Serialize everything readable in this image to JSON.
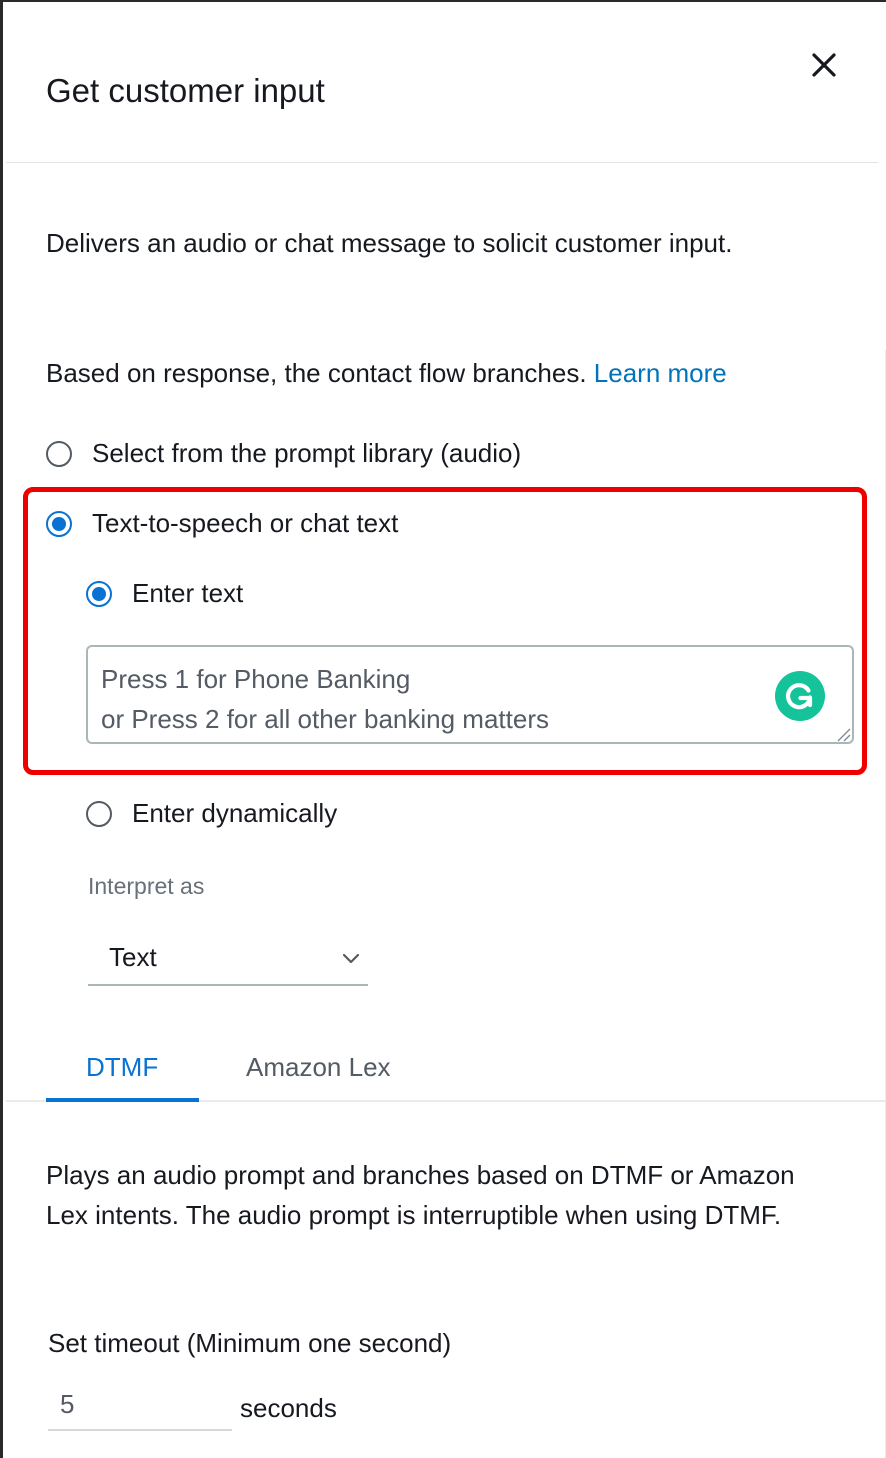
{
  "header": {
    "title": "Get customer input",
    "close_icon": "close-icon"
  },
  "description": "Delivers an audio or chat message to solicit customer input.",
  "branching": {
    "text": "Based on response, the contact flow branches.",
    "link_label": "Learn more"
  },
  "prompt_options": [
    {
      "label": "Select from the prompt library (audio)",
      "checked": false
    },
    {
      "label": "Text-to-speech or chat text",
      "checked": true
    }
  ],
  "text_options": [
    {
      "label": "Enter text",
      "checked": true
    },
    {
      "label": "Enter dynamically",
      "checked": false
    }
  ],
  "text_input": {
    "line1": "Press 1 for Phone Banking",
    "line2": "or Press 2 for all other banking matters",
    "assistant_icon": "grammarly-icon"
  },
  "interpret": {
    "label": "Interpret as",
    "selected": "Text"
  },
  "tabs": [
    {
      "label": "DTMF",
      "active": true
    },
    {
      "label": "Amazon Lex",
      "active": false
    }
  ],
  "tab_description": "Plays an audio prompt and branches based on DTMF or Amazon Lex intents. The audio prompt is interruptible when using DTMF.",
  "timeout": {
    "label": "Set timeout (Minimum one second)",
    "value": "5",
    "unit": "seconds"
  },
  "colors": {
    "accent": "#0972d3",
    "link": "#0073bb",
    "highlight": "#ee0000",
    "grammarly": "#15c39a"
  }
}
